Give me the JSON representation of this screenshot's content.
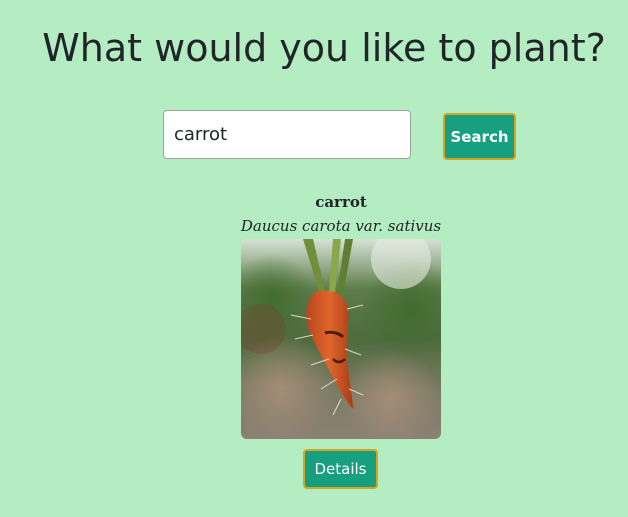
{
  "page": {
    "heading": "What would you like to plant?"
  },
  "search": {
    "value": "carrot",
    "button_label": "Search"
  },
  "result": {
    "common_name": "carrot",
    "scientific_name": "Daucus carota var. sativus",
    "image_alt": "carrot",
    "details_label": "Details"
  },
  "colors": {
    "background": "#b3edc1",
    "button": "#16a07f",
    "button_border": "#d9a520",
    "text": "#212529"
  }
}
